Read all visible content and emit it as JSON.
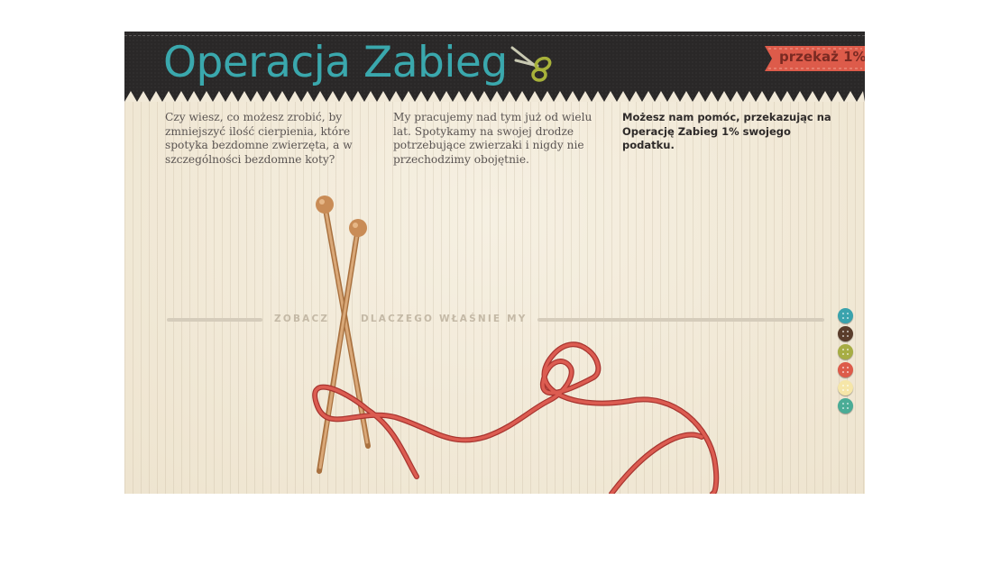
{
  "header": {
    "title": "Operacja Zabieg",
    "donate_label": "przekaż 1%"
  },
  "intro": {
    "col1": "Czy wiesz, co możesz zrobić, by zmniejszyć ilość cierpienia, które spotyka bezdomne zwierzęta, a w szczególności bezdomne koty?",
    "col2": "My pracujemy nad tym już od wielu lat. Spotykamy na swojej drodze potrzebujące zwierzaki i nigdy nie przechodzimy obojętnie.",
    "col3": "Możesz nam pomóc, przekazując na Operację Zabieg 1% swojego podatku."
  },
  "cta": {
    "part1": "ZOBACZ",
    "part2": "DLACZEGO WŁAŚNIE MY"
  },
  "nav_buttons": [
    {
      "name": "nav-button-teal",
      "color": "#3aa3ad"
    },
    {
      "name": "nav-button-brown",
      "color": "#5a3d2b"
    },
    {
      "name": "nav-button-olive",
      "color": "#a7ad44"
    },
    {
      "name": "nav-button-red",
      "color": "#dd5b4a"
    },
    {
      "name": "nav-button-cream",
      "color": "#f6e6a8"
    },
    {
      "name": "nav-button-green",
      "color": "#4aac96"
    }
  ],
  "colors": {
    "title": "#3aa8ad",
    "header_bg": "#2a2828",
    "ribbon": "#dd5b4a",
    "yarn": "#d4504a",
    "needle": "#c8935f"
  }
}
